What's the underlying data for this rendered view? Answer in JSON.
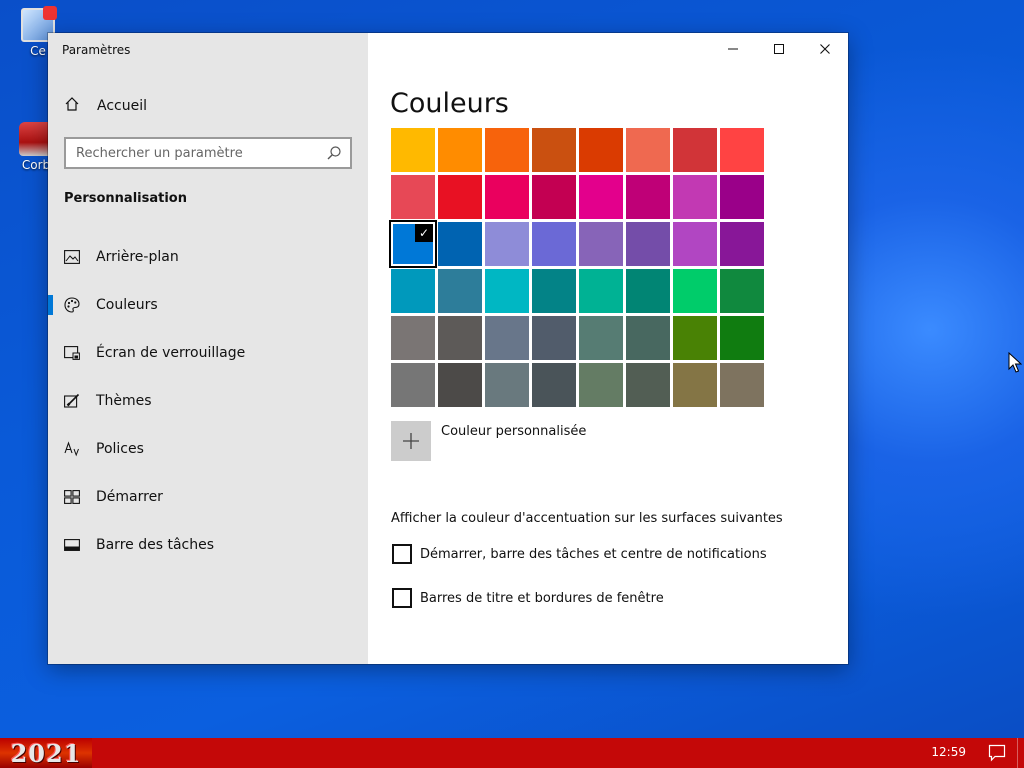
{
  "desktop": {
    "icons": [
      {
        "label": "Ce",
        "icon": "computer-icon"
      },
      {
        "label": "Corb",
        "icon": "recycle-bin-icon"
      }
    ]
  },
  "window": {
    "title": "Paramètres",
    "controls": {
      "minimize": "—",
      "maximize": "☐",
      "close": "✕"
    }
  },
  "sidebar": {
    "home_label": "Accueil",
    "search_placeholder": "Rechercher un paramètre",
    "section_title": "Personnalisation",
    "items": [
      {
        "label": "Arrière-plan",
        "icon": "image-icon",
        "active": false
      },
      {
        "label": "Couleurs",
        "icon": "palette-icon",
        "active": true
      },
      {
        "label": "Écran de verrouillage",
        "icon": "lock-screen-icon",
        "active": false
      },
      {
        "label": "Thèmes",
        "icon": "theme-brush-icon",
        "active": false
      },
      {
        "label": "Polices",
        "icon": "font-icon",
        "active": false
      },
      {
        "label": "Démarrer",
        "icon": "start-tiles-icon",
        "active": false
      },
      {
        "label": "Barre des tâches",
        "icon": "taskbar-icon",
        "active": false
      }
    ]
  },
  "content": {
    "title": "Couleurs",
    "swatches": [
      "#FFB900",
      "#FF8C00",
      "#F7630C",
      "#CA5010",
      "#DA3B01",
      "#EF6950",
      "#D13438",
      "#FF4343",
      "#E74856",
      "#E81123",
      "#EA005E",
      "#C30052",
      "#E3008C",
      "#BF0077",
      "#C239B3",
      "#9A0089",
      "#0078D7",
      "#0063B1",
      "#8E8CD8",
      "#6B69D6",
      "#8764B8",
      "#744DA9",
      "#B146C2",
      "#881798",
      "#0099BC",
      "#2D7D9A",
      "#00B7C3",
      "#038387",
      "#00B294",
      "#018574",
      "#00CC6A",
      "#10893E",
      "#7A7574",
      "#5D5A58",
      "#68768A",
      "#515C6B",
      "#567C73",
      "#486860",
      "#498205",
      "#107C10",
      "#767676",
      "#4C4A48",
      "#69797E",
      "#4A5459",
      "#647C64",
      "#525E54",
      "#847545",
      "#7E735F"
    ],
    "selected_index": 16,
    "custom_color_label": "Couleur personnalisée",
    "accent_surfaces_label": "Afficher la couleur d'accentuation sur les surfaces suivantes",
    "checkboxes": [
      {
        "label": "Démarrer, barre des tâches et centre de notifications",
        "checked": false
      },
      {
        "label": "Barres de titre et bordures de fenêtre",
        "checked": false
      }
    ]
  },
  "taskbar": {
    "start_label": "2021",
    "clock": "12:59",
    "color": "#C40808"
  }
}
